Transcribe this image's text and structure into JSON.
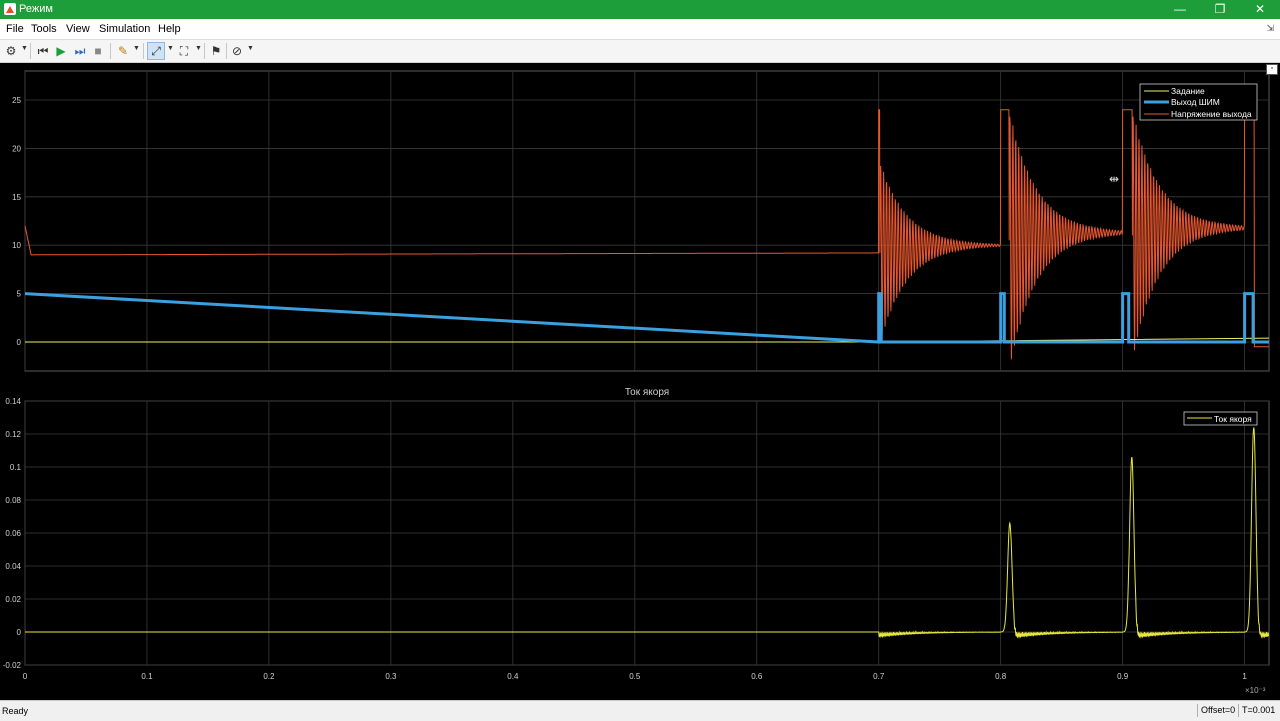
{
  "window": {
    "title": "Режим",
    "minimize": "—",
    "restore": "❐",
    "close": "✕"
  },
  "menu": {
    "items": [
      "File",
      "Tools",
      "View",
      "Simulation",
      "Help"
    ],
    "pin": "⇲"
  },
  "toolbar": {
    "icons": [
      "gear-icon",
      "step-back-icon",
      "run-icon",
      "step-forward-icon",
      "stop-icon",
      "highlight-icon",
      "zoom-axes-icon",
      "fit-view-icon",
      "triggers-icon",
      "measure-icon"
    ]
  },
  "top_plot": {
    "xlim": [
      0,
      0.00102
    ],
    "ylim": [
      -3,
      28
    ],
    "y_ticks": [
      0,
      5,
      10,
      15,
      20,
      25
    ],
    "legend": [
      {
        "label": "Задание",
        "color": "#f0f060"
      },
      {
        "label": "Выход ШИМ",
        "color": "#3aa0e0"
      },
      {
        "label": "Напряжение выхода",
        "color": "#e8572f"
      }
    ]
  },
  "bottom_plot": {
    "title": "Ток якоря",
    "xlim": [
      0,
      0.00102
    ],
    "ylim": [
      -0.02,
      0.14
    ],
    "y_ticks": [
      "-0.02",
      "0",
      "0.02",
      "0.04",
      "0.06",
      "0.08",
      "0.1",
      "0.12",
      "0.14"
    ],
    "x_ticks": [
      "0",
      "0.1",
      "0.2",
      "0.3",
      "0.4",
      "0.5",
      "0.6",
      "0.7",
      "0.8",
      "0.9",
      "1"
    ],
    "x_multiplier": "×10⁻³",
    "legend": [
      {
        "label": "Ток якоря",
        "color": "#e8e840"
      }
    ]
  },
  "chart_data": [
    {
      "type": "line",
      "x_unit": "s",
      "series": [
        {
          "name": "Задание",
          "x": [
            0,
            0.0007,
            0.00102
          ],
          "y": [
            0,
            0,
            0.4
          ]
        },
        {
          "name": "Выход ШИМ",
          "x": [
            0,
            0.0007,
            0.0007,
            0.000702,
            0.000702,
            0.0008,
            0.0008,
            0.000803,
            0.000803,
            0.0009,
            0.0009,
            0.000905,
            0.000905,
            0.001,
            0.001,
            0.001007,
            0.001007,
            0.00102
          ],
          "y": [
            5,
            0,
            5,
            5,
            0,
            0,
            5,
            5,
            0,
            0,
            5,
            5,
            0,
            0,
            5,
            5,
            0,
            0
          ]
        },
        {
          "name": "Напряжение выхода",
          "x": [
            0,
            5e-06,
            0.0007,
            0.0007,
            0.0008,
            0.0008,
            0.000803,
            0.0009,
            0.0009,
            0.000905,
            0.001,
            0.001,
            0.001007
          ],
          "y": [
            12,
            9,
            9.2,
            18.5,
            10,
            24,
            24,
            11.5,
            24,
            24,
            12,
            25,
            -0.5
          ]
        }
      ]
    },
    {
      "type": "line",
      "title": "Ток якоря",
      "x_unit": "s",
      "series": [
        {
          "name": "Ток якоря",
          "x": [
            0,
            0.0007,
            0.000805,
            0.000808,
            0.000811,
            0.000905,
            0.000908,
            0.000911,
            0.001007,
            0.00101,
            0.001015
          ],
          "y": [
            0,
            0,
            0.0,
            0.066,
            -0.003,
            0.0,
            0.106,
            -0.003,
            0.0,
            0.124,
            0.0
          ]
        }
      ]
    }
  ],
  "status": {
    "ready": "Ready",
    "offset": "Offset=0",
    "time": "T=0.001"
  }
}
